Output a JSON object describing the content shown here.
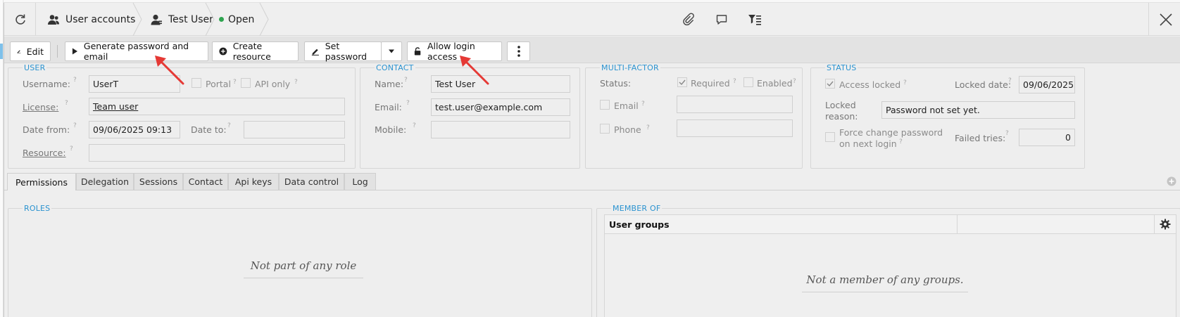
{
  "header": {
    "breadcrumbs": [
      {
        "label": "User accounts",
        "icon": "user-group-icon"
      },
      {
        "label": "Test User",
        "icon": "user-icon"
      },
      {
        "label": "Open",
        "icon": "status-dot-icon",
        "dot_color": "#2ea44f"
      }
    ],
    "icons": [
      "refresh-icon",
      "paperclip-icon",
      "comment-icon",
      "filter-list-icon",
      "close-icon"
    ]
  },
  "toolbar": {
    "edit_label": "Edit",
    "generate_label": "Generate password and email",
    "create_resource_label": "Create resource",
    "set_password_label": "Set password",
    "allow_login_label": "Allow login access"
  },
  "user": {
    "legend": "USER",
    "username_label": "Username:",
    "username": "UserT",
    "portal_label": "Portal",
    "api_only_label": "API only",
    "license_label": "License:",
    "license": "Team user",
    "date_from_label": "Date from:",
    "date_from": "09/06/2025 09:13",
    "date_to_label": "Date to:",
    "date_to": "",
    "resource_label": "Resource:",
    "resource": ""
  },
  "contact": {
    "legend": "CONTACT",
    "name_label": "Name:",
    "name": "Test User",
    "email_label": "Email:",
    "email": "test.user@example.com",
    "mobile_label": "Mobile:",
    "mobile": ""
  },
  "mfa": {
    "legend": "MULTI-FACTOR",
    "status_label": "Status:",
    "required_label": "Required",
    "enabled_label": "Enabled",
    "email_label": "Email",
    "phone_label": "Phone"
  },
  "status": {
    "legend": "STATUS",
    "access_locked_label": "Access locked",
    "locked_date_label": "Locked date:",
    "locked_date": "09/06/2025",
    "locked_reason_label_1": "Locked",
    "locked_reason_label_2": "reason:",
    "locked_reason": "Password not set yet.",
    "force_change_label_1": "Force change password",
    "force_change_label_2": "on next login",
    "failed_tries_label": "Failed tries:",
    "failed_tries": "0"
  },
  "tabs": [
    "Permissions",
    "Delegation",
    "Sessions",
    "Contact",
    "Api keys",
    "Data control",
    "Log"
  ],
  "roles": {
    "legend": "ROLES",
    "empty": "Not part of any role"
  },
  "member_of": {
    "legend": "MEMBER OF",
    "column": "User groups",
    "empty": "Not a member of any groups."
  },
  "colors": {
    "accent": "#2b93d0",
    "arrow": "#e53935",
    "status_dot": "#2ea44f"
  }
}
